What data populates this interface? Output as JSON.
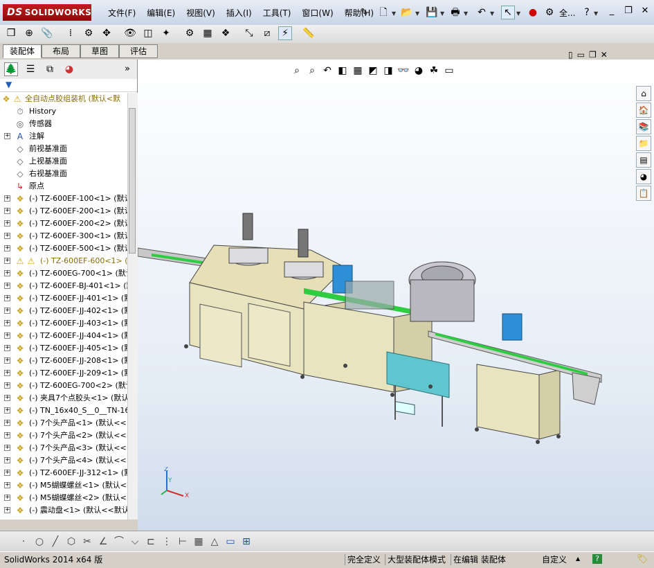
{
  "app": {
    "logo_prefix": "DS",
    "logo_text": "SOLIDWORKS"
  },
  "menu": [
    "文件(F)",
    "编辑(E)",
    "视图(V)",
    "插入(I)",
    "工具(T)",
    "窗口(W)",
    "帮助(H)"
  ],
  "title_overflow": "全...",
  "tabs": [
    "装配体",
    "布局",
    "草图",
    "评估"
  ],
  "tree": {
    "root": "全自动点胶组装机 (默认<默",
    "items": [
      {
        "label": "History",
        "icon": "history-icon",
        "expand": false
      },
      {
        "label": "传感器",
        "icon": "sensor-icon",
        "expand": false
      },
      {
        "label": "注解",
        "icon": "annotation-icon",
        "expand": true
      },
      {
        "label": "前视基准面",
        "icon": "plane-icon",
        "expand": false
      },
      {
        "label": "上视基准面",
        "icon": "plane-icon",
        "expand": false
      },
      {
        "label": "右视基准面",
        "icon": "plane-icon",
        "expand": false
      },
      {
        "label": "原点",
        "icon": "origin-icon",
        "expand": false
      },
      {
        "label": "(-) TZ-600EF-100<1> (默认<",
        "icon": "assembly-icon",
        "expand": true
      },
      {
        "label": "(-) TZ-600EF-200<1> (默认<",
        "icon": "assembly-icon",
        "expand": true
      },
      {
        "label": "(-) TZ-600EF-200<2> (默认<",
        "icon": "assembly-icon",
        "expand": true
      },
      {
        "label": "(-) TZ-600EF-300<1> (默认<",
        "icon": "assembly-icon",
        "expand": true
      },
      {
        "label": "(-) TZ-600EF-500<1> (默认<",
        "icon": "assembly-icon",
        "expand": true
      },
      {
        "label": "(-) TZ-600EF-600<1> (默",
        "icon": "warning-icon",
        "expand": true,
        "warn": true
      },
      {
        "label": "(-) TZ-600EG-700<1> (默认",
        "icon": "assembly-icon",
        "expand": true
      },
      {
        "label": "(-) TZ-600EF-BJ-401<1> (默",
        "icon": "assembly-icon",
        "expand": true
      },
      {
        "label": "(-) TZ-600EF-JJ-401<1> (默",
        "icon": "assembly-icon",
        "expand": true
      },
      {
        "label": "(-) TZ-600EF-JJ-402<1> (默",
        "icon": "assembly-icon",
        "expand": true
      },
      {
        "label": "(-) TZ-600EF-JJ-403<1> (默",
        "icon": "assembly-icon",
        "expand": true
      },
      {
        "label": "(-) TZ-600EF-JJ-404<1> (默",
        "icon": "assembly-icon",
        "expand": true
      },
      {
        "label": "(-) TZ-600EF-JJ-405<1> (默",
        "icon": "assembly-icon",
        "expand": true
      },
      {
        "label": "(-) TZ-600EF-JJ-208<1> (默",
        "icon": "assembly-icon",
        "expand": true
      },
      {
        "label": "(-) TZ-600EF-JJ-209<1> (默",
        "icon": "assembly-icon",
        "expand": true
      },
      {
        "label": "(-) TZ-600EG-700<2> (默认",
        "icon": "assembly-icon",
        "expand": true
      },
      {
        "label": "(-) 夹具7个点胶头<1> (默认",
        "icon": "assembly-icon",
        "expand": true
      },
      {
        "label": "(-) TN_16x40_S__0__TN-16x",
        "icon": "assembly-icon",
        "expand": true
      },
      {
        "label": "(-) 7个头产品<1> (默认<<",
        "icon": "part-icon",
        "expand": true
      },
      {
        "label": "(-) 7个头产品<2> (默认<<",
        "icon": "part-icon",
        "expand": true
      },
      {
        "label": "(-) 7个头产品<3> (默认<<",
        "icon": "part-icon",
        "expand": true
      },
      {
        "label": "(-) 7个头产品<4> (默认<<",
        "icon": "part-icon",
        "expand": true
      },
      {
        "label": "(-) TZ-600EF-JJ-312<1> (默",
        "icon": "assembly-icon",
        "expand": true
      },
      {
        "label": "(-) M5蝴蝶螺丝<1> (默认<",
        "icon": "part-icon",
        "expand": true
      },
      {
        "label": "(-) M5蝴蝶螺丝<2> (默认<",
        "icon": "part-icon",
        "expand": true
      },
      {
        "label": "(-) 震动盘<1> (默认<<默认",
        "icon": "part-icon",
        "expand": true
      }
    ]
  },
  "status": {
    "version": "SolidWorks 2014 x64 版",
    "s1": "完全定义",
    "s2": "大型装配体模式",
    "s3": "在编辑 装配体",
    "s4": "自定义"
  },
  "triad": {
    "x": "X",
    "y": "Y",
    "z": "Z"
  },
  "colors": {
    "accent_red": "#c21c1c",
    "machine_beige": "#e8e4c0",
    "conveyor_green": "#2ecc40",
    "panel_blue": "#2f8fd6",
    "console_cyan": "#5fc6d0"
  }
}
